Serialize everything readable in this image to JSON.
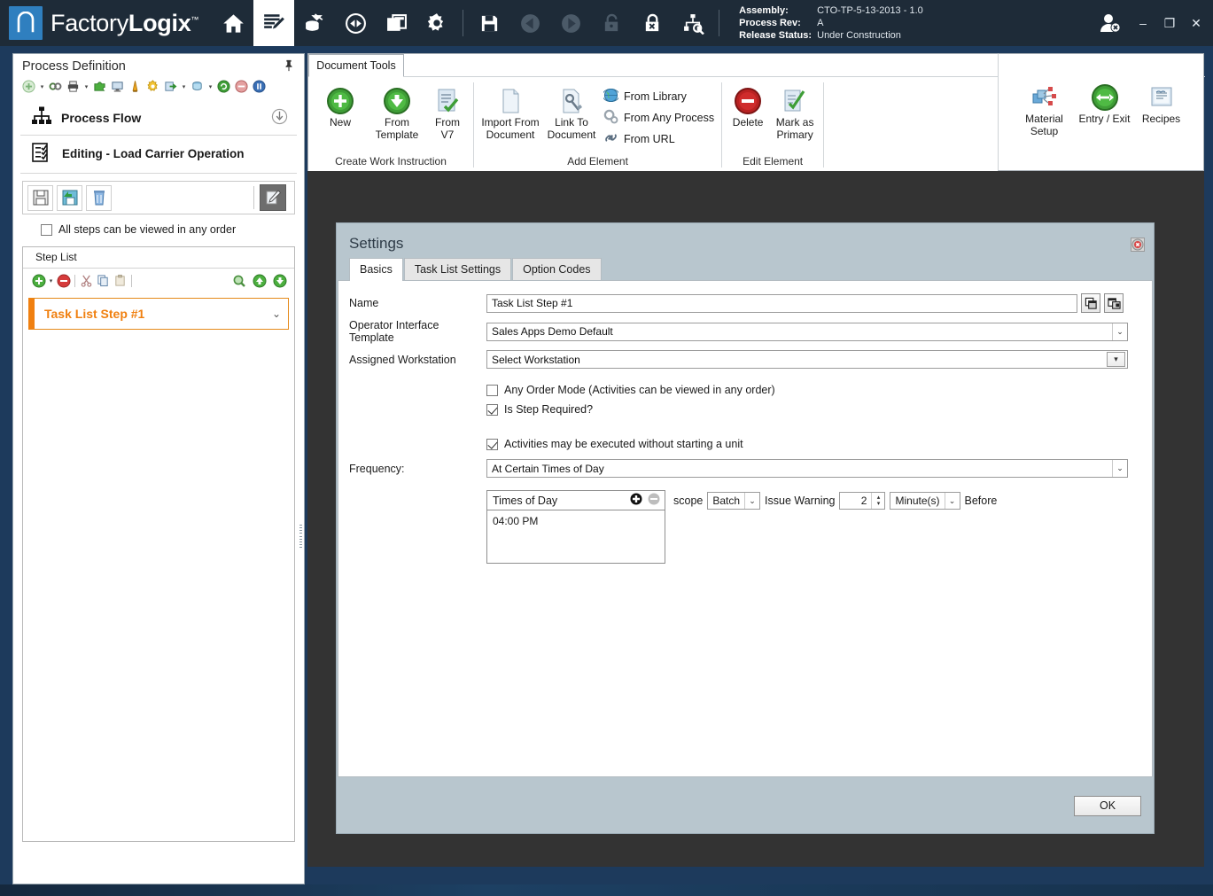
{
  "app": {
    "brand_light": "Factory",
    "brand_bold": "Logix",
    "brand_tm": "™",
    "logo_color": "#2f7fbf"
  },
  "topbar": {
    "icons": [
      {
        "name": "home-icon",
        "title": "Home"
      },
      {
        "name": "process-definition-icon",
        "title": "Process Definition",
        "active": true
      },
      {
        "name": "materials-icon",
        "title": "Materials"
      },
      {
        "name": "entry-exit-icon",
        "title": "Entry / Exit"
      },
      {
        "name": "windows-icon",
        "title": "Windows"
      },
      {
        "name": "settings-gear-icon",
        "title": "Settings"
      },
      {
        "name": "save-icon",
        "title": "Save"
      },
      {
        "name": "back-arrow-icon",
        "title": "Back"
      },
      {
        "name": "forward-arrow-icon",
        "title": "Forward"
      },
      {
        "name": "unlock-icon",
        "title": "Unlock"
      },
      {
        "name": "lock-close-icon",
        "title": "Lock"
      },
      {
        "name": "inspect-icon",
        "title": "Inspect"
      }
    ],
    "meta": [
      {
        "key": "Assembly:",
        "value": "CTO-TP-5-13-2013 - 1.0"
      },
      {
        "key": "Process Rev:",
        "value": "A"
      },
      {
        "key": "Release Status:",
        "value": "Under Construction"
      }
    ],
    "window_controls": {
      "user": "user-logout-icon",
      "minimize": "–",
      "maximize": "❐",
      "close": "✕"
    }
  },
  "sidebar": {
    "title": "Process Definition",
    "pin_icon": "pin-icon",
    "toolbar_icons": [
      "add-icon",
      "add-dropdown-caret",
      "link-icon",
      "print-icon",
      "print-dropdown-caret",
      "puzzle-icon",
      "monitor-icon",
      "bell-icon",
      "gear-orange-icon",
      "export-icon",
      "export-dropdown-caret",
      "import-icon",
      "import-dropdown-caret",
      "refresh-icon",
      "stop-icon",
      "pause-icon"
    ],
    "process_flow": {
      "label": "Process Flow",
      "icon": "hierarchy-icon",
      "collapse_icon": "collapse-down-icon"
    },
    "editing": {
      "label": "Editing - Load Carrier Operation",
      "icon": "checklist-icon"
    },
    "action_buttons": [
      {
        "name": "save-button",
        "icon": "floppy-icon"
      },
      {
        "name": "save-as-button",
        "icon": "floppy-up-icon"
      },
      {
        "name": "discard-button",
        "icon": "trash-icon"
      },
      {
        "name": "edit-mode-button",
        "icon": "edit-doc-icon"
      }
    ],
    "any_order_checkbox": {
      "label": "All steps can be viewed in any order",
      "checked": false
    },
    "step_list": {
      "title": "Step List",
      "toolbar_icons": [
        "add-step-icon",
        "add-step-caret",
        "remove-step-icon",
        "cut-icon",
        "copy-icon",
        "paste-icon",
        "find-icon",
        "move-up-icon",
        "move-down-icon"
      ],
      "steps": [
        {
          "name": "Task List Step #1",
          "selected": true,
          "chevron": "chevron-down-icon"
        }
      ]
    }
  },
  "ribbon": {
    "tab": "Document Tools",
    "groups": [
      {
        "label": "Create Work Instruction",
        "buttons": [
          {
            "name": "new-button",
            "label": "New",
            "icon": "green-plus-icon"
          },
          {
            "name": "from-template-button",
            "label": "From\nTemplate",
            "label_line1": "From",
            "label_line2": "Template",
            "icon": "green-down-icon"
          },
          {
            "name": "from-v7-button",
            "label_line1": "From",
            "label_line2": "V7",
            "icon": "doc-check-icon"
          }
        ]
      },
      {
        "label": "Add Element",
        "buttons": [
          {
            "name": "import-from-document-button",
            "label_line1": "Import From",
            "label_line2": "Document",
            "icon": "blank-doc-icon"
          },
          {
            "name": "link-to-document-button",
            "label_line1": "Link To",
            "label_line2": "Document",
            "icon": "doc-link-icon"
          }
        ],
        "small_items": [
          {
            "name": "from-library-item",
            "label": "From Library",
            "icon": "globe-icon"
          },
          {
            "name": "from-any-process-item",
            "label": "From Any Process",
            "icon": "gears-icon"
          },
          {
            "name": "from-url-item",
            "label": "From URL",
            "icon": "chain-link-icon"
          }
        ]
      },
      {
        "label": "Edit Element",
        "buttons": [
          {
            "name": "delete-button",
            "label": "Delete",
            "icon": "red-minus-icon"
          },
          {
            "name": "mark-as-primary-button",
            "label_line1": "Mark as",
            "label_line2": "Primary",
            "icon": "doc-checkmark-icon"
          }
        ]
      }
    ],
    "right_buttons": [
      {
        "name": "material-setup-button",
        "label_line1": "Material",
        "label_line2": "Setup",
        "icon": "material-setup-icon"
      },
      {
        "name": "entry-exit-button",
        "label_line1": "Entry / Exit",
        "label_line2": "",
        "icon": "green-arrows-icon"
      },
      {
        "name": "recipes-button",
        "label_line1": "Recipes",
        "label_line2": "",
        "icon": "recipes-icon"
      }
    ]
  },
  "dialog": {
    "title": "Settings",
    "close_icon": "close-dialog-icon",
    "tabs": [
      {
        "label": "Basics",
        "active": true
      },
      {
        "label": "Task List Settings",
        "active": false
      },
      {
        "label": "Option Codes",
        "active": false
      }
    ],
    "fields": {
      "name": {
        "label": "Name",
        "value": "Task List Step #1",
        "buttons": [
          {
            "name": "copy-name-button",
            "icon": "copy-window-icon"
          },
          {
            "name": "paste-name-button",
            "icon": "paste-window-icon"
          }
        ]
      },
      "operator_interface_template": {
        "label": "Operator Interface Template",
        "value": "Sales Apps Demo Default"
      },
      "assigned_workstation": {
        "label": "Assigned Workstation",
        "value": "Select Workstation"
      }
    },
    "checkboxes": [
      {
        "name": "any-order-mode-checkbox",
        "label": "Any Order Mode (Activities can be viewed in any order)",
        "checked": false
      },
      {
        "name": "is-step-required-checkbox",
        "label": "Is Step Required?",
        "checked": true
      },
      {
        "name": "activities-without-unit-checkbox",
        "label": "Activities may be executed without starting a unit",
        "checked": true
      }
    ],
    "frequency": {
      "label": "Frequency:",
      "value": "At Certain Times of Day"
    },
    "times_of_day": {
      "header": "Times of Day",
      "add_icon": "add-time-icon",
      "remove_icon": "remove-time-icon",
      "items": [
        "04:00 PM"
      ]
    },
    "warning": {
      "scope_label": "scope",
      "scope_value": "Batch",
      "issue_warning_label": "Issue Warning",
      "amount": "2",
      "unit": "Minute(s)",
      "before_label": "Before"
    },
    "ok_button": "OK"
  }
}
